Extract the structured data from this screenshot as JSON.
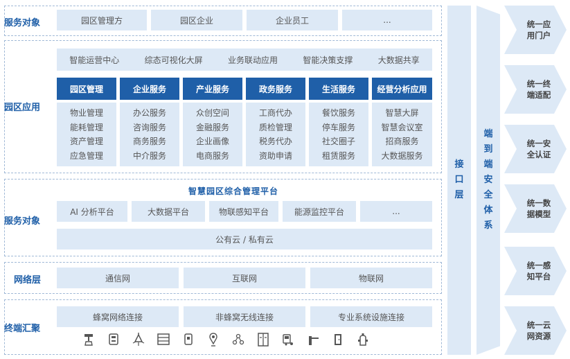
{
  "service_top": {
    "label": "服务对象",
    "items": [
      "园区管理方",
      "园区企业",
      "企业员工",
      "..."
    ]
  },
  "park_apps": {
    "label": "园区应用",
    "top_items": [
      "智能运营中心",
      "综态可视化大屏",
      "业务联动应用",
      "智能决策支撑",
      "大数据共享"
    ],
    "columns": [
      {
        "header": "园区管理",
        "items": [
          "物业管理",
          "能耗管理",
          "资产管理",
          "应急管理"
        ]
      },
      {
        "header": "企业服务",
        "items": [
          "办公服务",
          "咨询服务",
          "商务服务",
          "中介服务"
        ]
      },
      {
        "header": "产业服务",
        "items": [
          "众创空间",
          "金融服务",
          "企业画像",
          "电商服务"
        ]
      },
      {
        "header": "政务服务",
        "items": [
          "工商代办",
          "质检管理",
          "税务代办",
          "资助申请"
        ]
      },
      {
        "header": "生活服务",
        "items": [
          "餐饮服务",
          "停车服务",
          "社交圈子",
          "租赁服务"
        ]
      },
      {
        "header": "经营分析应用",
        "items": [
          "智慧大屏",
          "智慧会议室",
          "招商服务",
          "大数据服务"
        ]
      }
    ]
  },
  "platform": {
    "label": "服务对象",
    "title": "智慧园区综合管理平台",
    "items": [
      "AI 分析平台",
      "大数据平台",
      "物联感知平台",
      "能源监控平台",
      "..."
    ],
    "cloud": "公有云 / 私有云"
  },
  "network": {
    "label": "网络层",
    "items": [
      "通信网",
      "互联网",
      "物联网"
    ]
  },
  "terminal": {
    "label": "终端汇聚",
    "items": [
      "蜂窝网络连接",
      "非蜂窝无线连接",
      "专业系统设施连接"
    ],
    "icons": [
      "faucet-icon",
      "meter-icon",
      "light-icon",
      "cabinet-icon",
      "device-icon",
      "location-icon",
      "network-icon",
      "elevator-icon",
      "car-icon",
      "gate-icon",
      "door-icon",
      "hydrant-icon"
    ]
  },
  "interface_layer": "接口层",
  "security_system": "端到端安全体系",
  "unified": [
    "统一应用门户",
    "统一终端适配",
    "统一安全认证",
    "统一数据模型",
    "统一感知平台",
    "统一云网资源"
  ],
  "colors": {
    "primary": "#1f5fa8",
    "cell_bg": "#dde9f6"
  }
}
